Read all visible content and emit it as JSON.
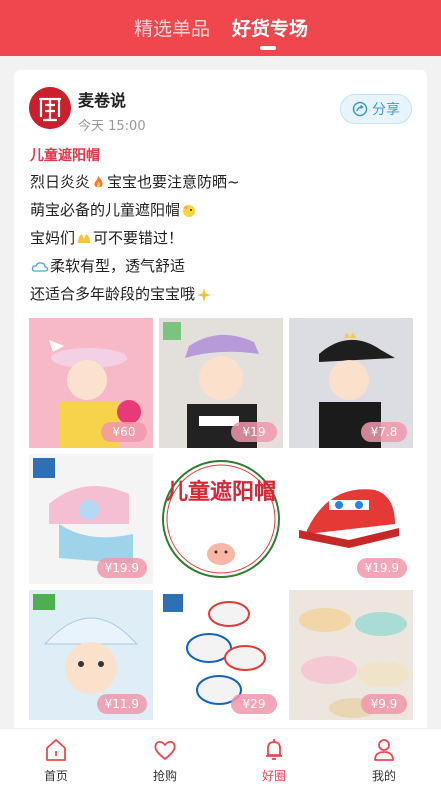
{
  "header": {
    "tabs": [
      {
        "label": "精选单品"
      },
      {
        "label": "好货专场"
      }
    ],
    "active_tab": 1
  },
  "post": {
    "author": "麦卷说",
    "time": "今天 15:00",
    "share_label": "分享",
    "title": "儿童遮阳帽",
    "lines": [
      {
        "text": "烈日炎炎",
        "emoji": "fire",
        "text2": "宝宝也要注意防晒~"
      },
      {
        "text": "萌宝必备的儿童遮阳帽",
        "emoji": "baby-chick",
        "text2": ""
      },
      {
        "text": "宝妈们",
        "emoji": "hands",
        "text2": "可不要错过！"
      },
      {
        "text": "",
        "emoji": "cloud",
        "text2": "柔软有型，透气舒适"
      },
      {
        "text": "还适合多年龄段的宝宝哦",
        "emoji": "sparkle",
        "text2": ""
      }
    ],
    "center_tile_text": "儿童遮阳帽",
    "products": [
      {
        "price": "¥60"
      },
      {
        "price": "¥19"
      },
      {
        "price": "¥7.8"
      },
      {
        "price": "¥19.9"
      },
      {
        "price": ""
      },
      {
        "price": "¥19.9"
      },
      {
        "price": "¥11.9"
      },
      {
        "price": "¥29"
      },
      {
        "price": "¥9.9"
      }
    ]
  },
  "bottom_nav": {
    "items": [
      {
        "label": "首页"
      },
      {
        "label": "抢购"
      },
      {
        "label": "好圈"
      },
      {
        "label": "我的"
      }
    ],
    "active_index": 2
  },
  "colors": {
    "brand": "#f0474f",
    "share": "#3a9ad9",
    "title_red": "#e8364a"
  }
}
